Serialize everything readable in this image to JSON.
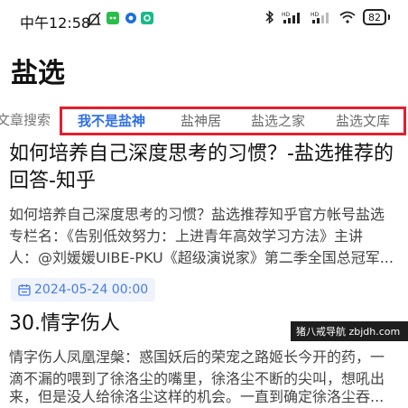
{
  "status": {
    "time": "中午12:58",
    "battery": "82"
  },
  "page": {
    "title": "盐选"
  },
  "tabs": {
    "prev": "文章搜索",
    "items": [
      "我不是盐神",
      "盐神居",
      "盐选之家",
      "盐选文库"
    ],
    "active_index": 0
  },
  "articles": [
    {
      "title_line1": "如何培养自己深度思考的习惯？-盐选推荐的",
      "title_line2": "回答-知乎",
      "body_line1": "如何培养自己深度思考的习惯？盐选推荐知乎官方帐号盐选",
      "body_line2": "专栏名：《告别低效努力：上进青年高效学习方法》主讲",
      "body_line3": "人：@刘媛媛UIBE-PKU《超级演说家》第二季全国总冠军...",
      "date": "2024-05-24 00:00"
    },
    {
      "title_line1": "30.情字伤人",
      "body_line1": "情字伤人凤凰涅槃：惑国妖后的荣宠之路姬长今开的药，一",
      "body_line2": "滴不漏的喂到了徐洛尘的嘴里，徐洛尘不断的尖叫，想吼出",
      "body_line3": "来，但是没人给徐洛尘这样的机会。一直到确定徐洛尘吞..."
    }
  ],
  "watermark": "猪八戒导航 zbjdh.com",
  "colors": {
    "accent": "#2f6fe6",
    "highlight_box": "#e41e2f"
  }
}
